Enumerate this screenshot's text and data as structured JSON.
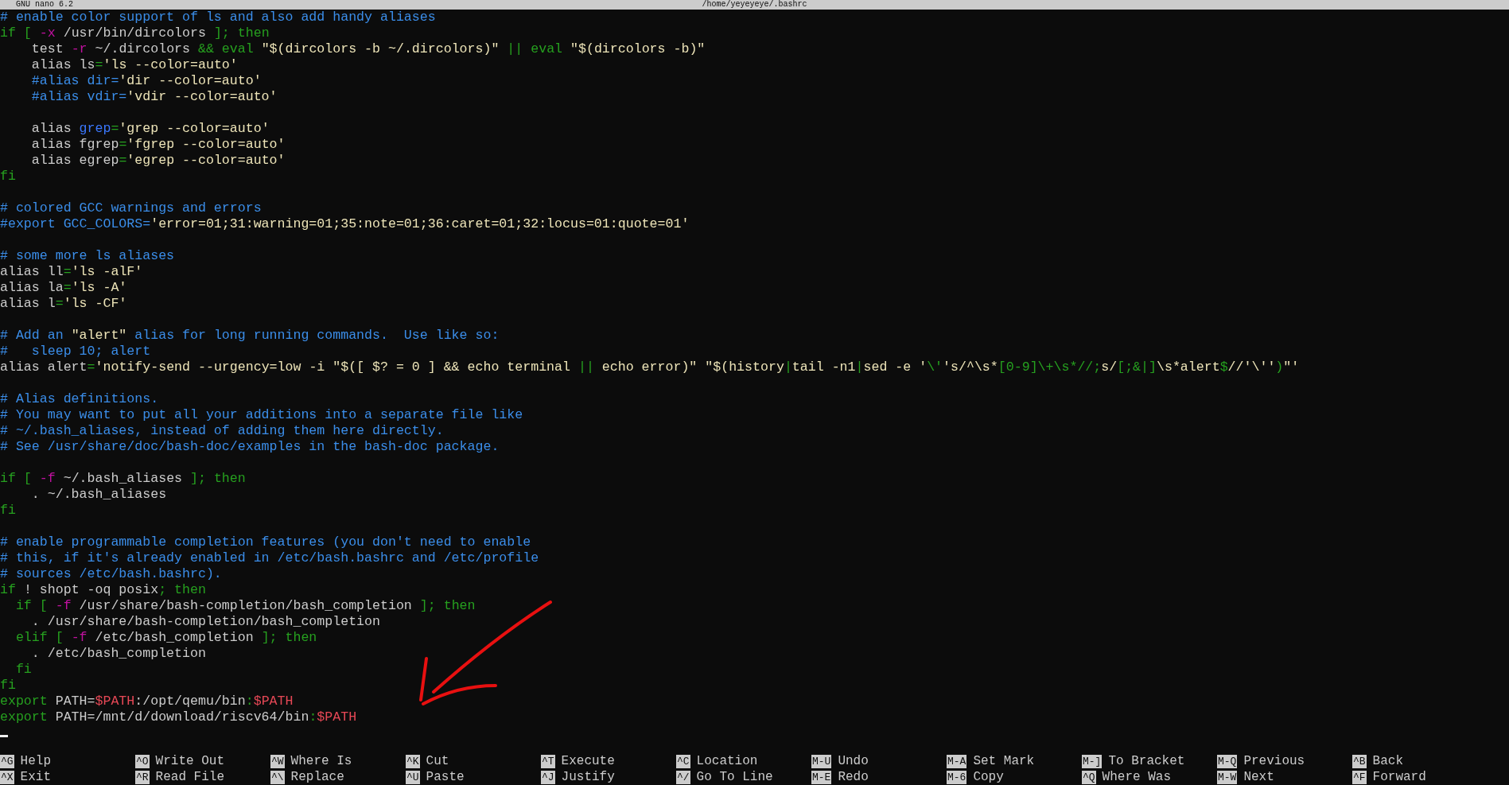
{
  "title_bar": {
    "app": "GNU nano 6.2",
    "file": "/home/yeyeyeye/.bashrc"
  },
  "lines": [
    {
      "kind": "code",
      "segments": [
        {
          "kind": "comment",
          "text": "# enable color support of ls and also add handy aliases"
        }
      ]
    },
    {
      "kind": "code",
      "segments": [
        {
          "kind": "keyword",
          "text": "if [ "
        },
        {
          "kind": "option",
          "text": "-x"
        },
        {
          "kind": "plain",
          "text": " /usr/bin/dircolors "
        },
        {
          "kind": "keyword",
          "text": "]; then"
        }
      ]
    },
    {
      "kind": "code",
      "segments": [
        {
          "kind": "plain",
          "text": "    test "
        },
        {
          "kind": "option",
          "text": "-r"
        },
        {
          "kind": "plain",
          "text": " ~/.dircolors "
        },
        {
          "kind": "keyword",
          "text": "&& eval"
        },
        {
          "kind": "string",
          "text": " \"$(dircolors -b ~/.dircolors)\" "
        },
        {
          "kind": "keyword",
          "text": "|| eval"
        },
        {
          "kind": "string",
          "text": " \"$(dircolors -b)\""
        }
      ]
    },
    {
      "kind": "code",
      "segments": [
        {
          "kind": "plain",
          "text": "    alias ls"
        },
        {
          "kind": "keyword",
          "text": "="
        },
        {
          "kind": "string",
          "text": "'ls --color=auto'"
        }
      ]
    },
    {
      "kind": "code",
      "segments": [
        {
          "kind": "comment",
          "text": "    #alias dir="
        },
        {
          "kind": "string",
          "text": "'dir --color=auto'"
        }
      ]
    },
    {
      "kind": "code",
      "segments": [
        {
          "kind": "comment",
          "text": "    #alias vdir="
        },
        {
          "kind": "string",
          "text": "'vdir --color=auto'"
        }
      ]
    },
    {
      "kind": "blank"
    },
    {
      "kind": "code",
      "segments": [
        {
          "kind": "plain",
          "text": "    alias "
        },
        {
          "kind": "builtin",
          "text": "grep"
        },
        {
          "kind": "keyword",
          "text": "="
        },
        {
          "kind": "string",
          "text": "'grep --color=auto'"
        }
      ]
    },
    {
      "kind": "code",
      "segments": [
        {
          "kind": "plain",
          "text": "    alias fgrep"
        },
        {
          "kind": "keyword",
          "text": "="
        },
        {
          "kind": "string",
          "text": "'fgrep --color=auto'"
        }
      ]
    },
    {
      "kind": "code",
      "segments": [
        {
          "kind": "plain",
          "text": "    alias egrep"
        },
        {
          "kind": "keyword",
          "text": "="
        },
        {
          "kind": "string",
          "text": "'egrep --color=auto'"
        }
      ]
    },
    {
      "kind": "code",
      "segments": [
        {
          "kind": "keyword",
          "text": "fi"
        }
      ]
    },
    {
      "kind": "blank"
    },
    {
      "kind": "code",
      "segments": [
        {
          "kind": "comment",
          "text": "# colored GCC warnings and errors"
        }
      ]
    },
    {
      "kind": "code",
      "segments": [
        {
          "kind": "comment",
          "text": "#export GCC_COLORS="
        },
        {
          "kind": "string",
          "text": "'error=01;31:warning=01;35:note=01;36:caret=01;32:locus=01:quote=01'"
        }
      ]
    },
    {
      "kind": "blank"
    },
    {
      "kind": "code",
      "segments": [
        {
          "kind": "comment",
          "text": "# some more ls aliases"
        }
      ]
    },
    {
      "kind": "code",
      "segments": [
        {
          "kind": "plain",
          "text": "alias ll"
        },
        {
          "kind": "keyword",
          "text": "="
        },
        {
          "kind": "string",
          "text": "'ls -alF'"
        }
      ]
    },
    {
      "kind": "code",
      "segments": [
        {
          "kind": "plain",
          "text": "alias la"
        },
        {
          "kind": "keyword",
          "text": "="
        },
        {
          "kind": "string",
          "text": "'ls -A'"
        }
      ]
    },
    {
      "kind": "code",
      "segments": [
        {
          "kind": "plain",
          "text": "alias l"
        },
        {
          "kind": "keyword",
          "text": "="
        },
        {
          "kind": "string",
          "text": "'ls -CF'"
        }
      ]
    },
    {
      "kind": "blank"
    },
    {
      "kind": "code",
      "segments": [
        {
          "kind": "comment",
          "text": "# Add an "
        },
        {
          "kind": "string",
          "text": "\"alert\""
        },
        {
          "kind": "comment",
          "text": " alias for long running commands.  Use like so:"
        }
      ]
    },
    {
      "kind": "code",
      "segments": [
        {
          "kind": "comment",
          "text": "#   sleep 10; alert"
        }
      ]
    },
    {
      "kind": "code",
      "segments": [
        {
          "kind": "plain",
          "text": "alias alert"
        },
        {
          "kind": "keyword",
          "text": "="
        },
        {
          "kind": "string",
          "text": "'notify-send --urgency=low -i \"$([ $? = 0 ] && echo terminal "
        },
        {
          "kind": "keyword",
          "text": "||"
        },
        {
          "kind": "string",
          "text": " echo error)\" \"$(history"
        },
        {
          "kind": "keyword",
          "text": "|"
        },
        {
          "kind": "string",
          "text": "tail -n1"
        },
        {
          "kind": "keyword",
          "text": "|"
        },
        {
          "kind": "string",
          "text": "sed -e '"
        },
        {
          "kind": "keyword",
          "text": "\\'"
        },
        {
          "kind": "string",
          "text": "'s/^\\s*"
        },
        {
          "kind": "keyword",
          "text": "[0-9]\\+\\s*//;"
        },
        {
          "kind": "string",
          "text": "s/"
        },
        {
          "kind": "keyword",
          "text": "[;&|]"
        },
        {
          "kind": "string",
          "text": "\\s*alert"
        },
        {
          "kind": "keyword",
          "text": "$"
        },
        {
          "kind": "string",
          "text": "//'\\''"
        },
        {
          "kind": "keyword",
          "text": ")"
        },
        {
          "kind": "string",
          "text": "\"'"
        }
      ]
    },
    {
      "kind": "blank"
    },
    {
      "kind": "code",
      "segments": [
        {
          "kind": "comment",
          "text": "# Alias definitions."
        }
      ]
    },
    {
      "kind": "code",
      "segments": [
        {
          "kind": "comment",
          "text": "# You may want to put all your additions into a separate file like"
        }
      ]
    },
    {
      "kind": "code",
      "segments": [
        {
          "kind": "comment",
          "text": "# ~/.bash_aliases, instead of adding them here directly."
        }
      ]
    },
    {
      "kind": "code",
      "segments": [
        {
          "kind": "comment",
          "text": "# See /usr/share/doc/bash-doc/examples in the bash-doc package."
        }
      ]
    },
    {
      "kind": "blank"
    },
    {
      "kind": "code",
      "segments": [
        {
          "kind": "keyword",
          "text": "if [ "
        },
        {
          "kind": "option",
          "text": "-f"
        },
        {
          "kind": "plain",
          "text": " ~/.bash_aliases "
        },
        {
          "kind": "keyword",
          "text": "]; then"
        }
      ]
    },
    {
      "kind": "code",
      "segments": [
        {
          "kind": "plain",
          "text": "    . ~/.bash_aliases"
        }
      ]
    },
    {
      "kind": "code",
      "segments": [
        {
          "kind": "keyword",
          "text": "fi"
        }
      ]
    },
    {
      "kind": "blank"
    },
    {
      "kind": "code",
      "segments": [
        {
          "kind": "comment",
          "text": "# enable programmable completion features (you don't need to enable"
        }
      ]
    },
    {
      "kind": "code",
      "segments": [
        {
          "kind": "comment",
          "text": "# this, if it's already enabled in /etc/bash.bashrc and /etc/profile"
        }
      ]
    },
    {
      "kind": "code",
      "segments": [
        {
          "kind": "comment",
          "text": "# sources /etc/bash.bashrc)."
        }
      ]
    },
    {
      "kind": "code",
      "segments": [
        {
          "kind": "keyword",
          "text": "if"
        },
        {
          "kind": "plain",
          "text": " ! shopt -oq posix"
        },
        {
          "kind": "keyword",
          "text": "; then"
        }
      ]
    },
    {
      "kind": "code",
      "segments": [
        {
          "kind": "keyword",
          "text": "  if [ "
        },
        {
          "kind": "option",
          "text": "-f"
        },
        {
          "kind": "plain",
          "text": " /usr/share/bash-completion/bash_completion "
        },
        {
          "kind": "keyword",
          "text": "]; then"
        }
      ]
    },
    {
      "kind": "code",
      "segments": [
        {
          "kind": "plain",
          "text": "    . /usr/share/bash-completion/bash_completion"
        }
      ]
    },
    {
      "kind": "code",
      "segments": [
        {
          "kind": "keyword",
          "text": "  elif [ "
        },
        {
          "kind": "option",
          "text": "-f"
        },
        {
          "kind": "plain",
          "text": " /etc/bash_completion "
        },
        {
          "kind": "keyword",
          "text": "]; then"
        }
      ]
    },
    {
      "kind": "code",
      "segments": [
        {
          "kind": "plain",
          "text": "    . /etc/bash_completion"
        }
      ]
    },
    {
      "kind": "code",
      "segments": [
        {
          "kind": "keyword",
          "text": "  fi"
        }
      ]
    },
    {
      "kind": "code",
      "segments": [
        {
          "kind": "keyword",
          "text": "fi"
        }
      ]
    },
    {
      "kind": "code",
      "segments": [
        {
          "kind": "keyword",
          "text": "export"
        },
        {
          "kind": "plain",
          "text": " PATH="
        },
        {
          "kind": "variable",
          "text": "$PATH"
        },
        {
          "kind": "plain",
          "text": ":/opt/qemu/bin"
        },
        {
          "kind": "keyword",
          "text": ":"
        },
        {
          "kind": "variable",
          "text": "$PATH"
        }
      ]
    },
    {
      "kind": "code",
      "segments": [
        {
          "kind": "keyword",
          "text": "export"
        },
        {
          "kind": "plain",
          "text": " PATH=/mnt/d/download/riscv64/bin"
        },
        {
          "kind": "keyword",
          "text": ":"
        },
        {
          "kind": "variable",
          "text": "$PATH"
        }
      ]
    }
  ],
  "shortcut_rows": [
    [
      {
        "key": "^G",
        "label": "Help"
      },
      {
        "key": "^O",
        "label": "Write Out"
      },
      {
        "key": "^W",
        "label": "Where Is"
      },
      {
        "key": "^K",
        "label": "Cut"
      },
      {
        "key": "^T",
        "label": "Execute"
      },
      {
        "key": "^C",
        "label": "Location"
      },
      {
        "key": "M-U",
        "label": "Undo"
      },
      {
        "key": "M-A",
        "label": "Set Mark"
      },
      {
        "key": "M-]",
        "label": "To Bracket"
      },
      {
        "key": "M-Q",
        "label": "Previous"
      },
      {
        "key": "^B",
        "label": "Back"
      }
    ],
    [
      {
        "key": "^X",
        "label": "Exit"
      },
      {
        "key": "^R",
        "label": "Read File"
      },
      {
        "key": "^\\",
        "label": "Replace"
      },
      {
        "key": "^U",
        "label": "Paste"
      },
      {
        "key": "^J",
        "label": "Justify"
      },
      {
        "key": "^/",
        "label": "Go To Line"
      },
      {
        "key": "M-E",
        "label": "Redo"
      },
      {
        "key": "M-6",
        "label": "Copy"
      },
      {
        "key": "^Q",
        "label": "Where Was"
      },
      {
        "key": "M-W",
        "label": "Next"
      },
      {
        "key": "^F",
        "label": "Forward"
      }
    ]
  ]
}
